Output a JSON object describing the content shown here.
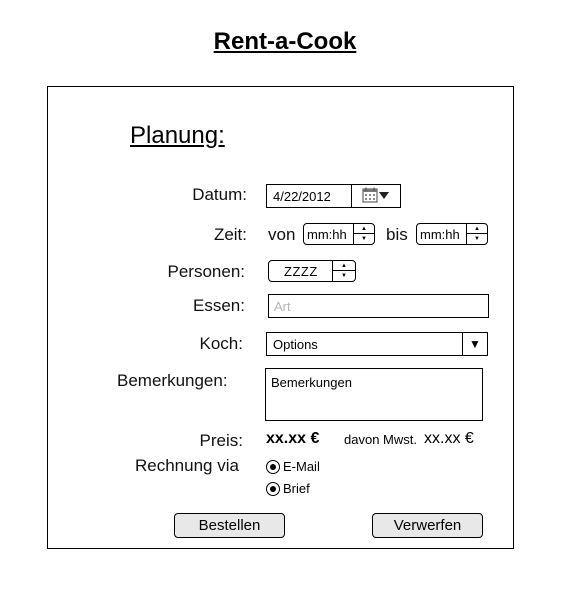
{
  "app": {
    "title": "Rent-a-Cook"
  },
  "form": {
    "section_title": "Planung:",
    "date": {
      "label": "Datum:",
      "value": "4/22/2012",
      "button_icon": "calendar-icon"
    },
    "time": {
      "label": "Zeit:",
      "from_label": "von",
      "from_value": "mm:hh",
      "to_label": "bis",
      "to_value": "mm:hh"
    },
    "persons": {
      "label": "Personen:",
      "value": "ZZZZ"
    },
    "food": {
      "label": "Essen:",
      "placeholder": "Art"
    },
    "cook": {
      "label": "Koch:",
      "selected": "Options"
    },
    "remarks": {
      "label": "Bemerkungen:",
      "value": "Bemerkungen"
    },
    "price": {
      "label": "Preis:",
      "value": "xx.xx €",
      "tax_label": "davon Mwst.",
      "tax_value": "xx.xx €"
    },
    "invoice": {
      "label": "Rechnung via",
      "options": [
        "E-Mail",
        "Brief"
      ]
    },
    "buttons": {
      "order": "Bestellen",
      "discard": "Verwerfen"
    }
  }
}
